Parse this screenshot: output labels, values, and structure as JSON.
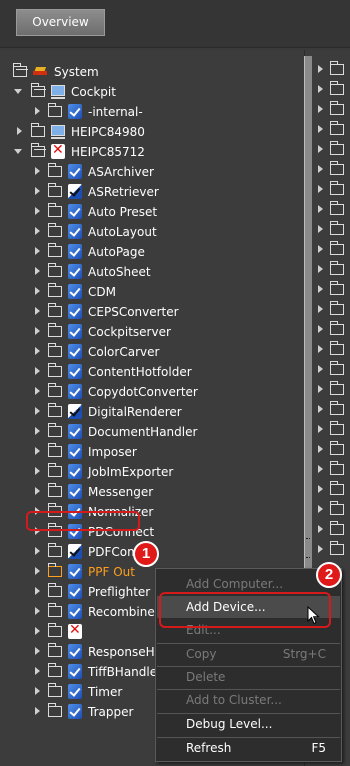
{
  "header": {
    "tab_overview": "Overview"
  },
  "tree": {
    "system": "System",
    "cockpit": "Cockpit",
    "internal": "-internal-",
    "heipc84980": "HEIPC84980",
    "heipc85712": "HEIPC85712",
    "children": [
      {
        "label": "ASArchiver",
        "status": "ok"
      },
      {
        "label": "ASRetriever",
        "status": "warn"
      },
      {
        "label": "Auto Preset",
        "status": "ok"
      },
      {
        "label": "AutoLayout",
        "status": "ok"
      },
      {
        "label": "AutoPage",
        "status": "ok"
      },
      {
        "label": "AutoSheet",
        "status": "ok"
      },
      {
        "label": "CDM",
        "status": "ok"
      },
      {
        "label": "CEPSConverter",
        "status": "ok"
      },
      {
        "label": "Cockpitserver",
        "status": "ok"
      },
      {
        "label": "ColorCarver",
        "status": "ok"
      },
      {
        "label": "ContentHotfolder",
        "status": "ok"
      },
      {
        "label": "CopydotConverter",
        "status": "ok"
      },
      {
        "label": "DigitalRenderer",
        "status": "warn"
      },
      {
        "label": "DocumentHandler",
        "status": "ok"
      },
      {
        "label": "Imposer",
        "status": "ok"
      },
      {
        "label": "JobImExporter",
        "status": "ok"
      },
      {
        "label": "Messenger",
        "status": "ok"
      },
      {
        "label": "Normalizer",
        "status": "ok"
      },
      {
        "label": "PDConnect",
        "status": "ok"
      },
      {
        "label": "PDFComp",
        "status": "warn"
      },
      {
        "label": "PPF Out",
        "status": "ok"
      },
      {
        "label": "Preflighter",
        "status": "ok"
      },
      {
        "label": "Recombiner",
        "status": "ok"
      },
      {
        "label": "",
        "status": "error"
      },
      {
        "label": "ResponseH",
        "status": "ok"
      },
      {
        "label": "TiffBHandler",
        "status": "ok"
      },
      {
        "label": "Timer",
        "status": "ok"
      },
      {
        "label": "Trapper",
        "status": "ok"
      }
    ]
  },
  "context_menu": {
    "add_computer": "Add Computer...",
    "add_device": "Add Device...",
    "edit": "Edit...",
    "copy": "Copy",
    "copy_shortcut": "Strg+C",
    "delete": "Delete",
    "add_to_cluster": "Add to Cluster...",
    "debug_level": "Debug Level...",
    "refresh": "Refresh",
    "refresh_shortcut": "F5"
  },
  "callouts": {
    "one": "1",
    "two": "2"
  },
  "colors": {
    "accent_red": "#e01919",
    "selected_text": "#ff9f1c",
    "status_ok": "#1c4fb5"
  }
}
